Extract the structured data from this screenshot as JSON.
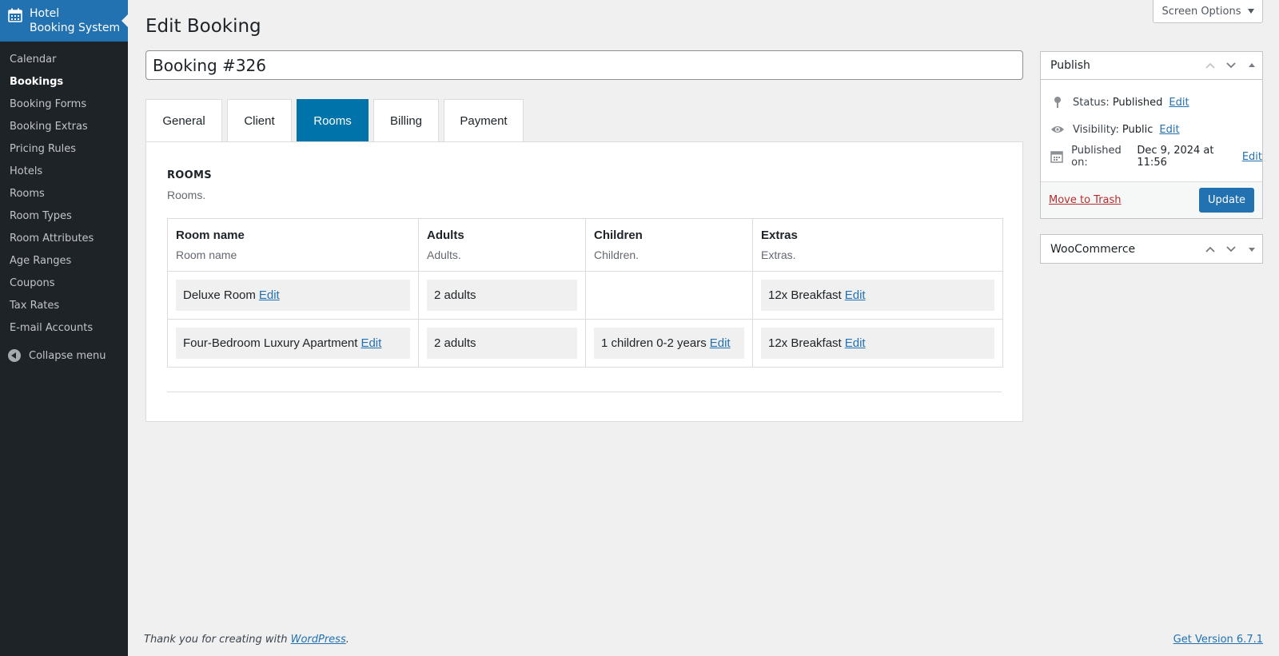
{
  "sidebar": {
    "brand_line1": "Hotel",
    "brand_line2": "Booking System",
    "items": [
      {
        "label": "Calendar"
      },
      {
        "label": "Bookings"
      },
      {
        "label": "Booking Forms"
      },
      {
        "label": "Booking Extras"
      },
      {
        "label": "Pricing Rules"
      },
      {
        "label": "Hotels"
      },
      {
        "label": "Rooms"
      },
      {
        "label": "Room Types"
      },
      {
        "label": "Room Attributes"
      },
      {
        "label": "Age Ranges"
      },
      {
        "label": "Coupons"
      },
      {
        "label": "Tax Rates"
      },
      {
        "label": "E-mail Accounts"
      }
    ],
    "collapse_label": "Collapse menu"
  },
  "header": {
    "screen_options": "Screen Options",
    "page_title": "Edit Booking",
    "booking_title": "Booking #326"
  },
  "tabs": [
    {
      "label": "General"
    },
    {
      "label": "Client"
    },
    {
      "label": "Rooms"
    },
    {
      "label": "Billing"
    },
    {
      "label": "Payment"
    }
  ],
  "rooms": {
    "heading": "ROOMS",
    "description": "Rooms.",
    "columns": [
      {
        "title": "Room name",
        "sub": "Room name"
      },
      {
        "title": "Adults",
        "sub": "Adults."
      },
      {
        "title": "Children",
        "sub": "Children."
      },
      {
        "title": "Extras",
        "sub": "Extras."
      }
    ],
    "rows": [
      {
        "room": "Deluxe Room",
        "adults": "2 adults",
        "children": "",
        "extras": "12x Breakfast"
      },
      {
        "room": "Four-Bedroom Luxury Apartment",
        "adults": "2 adults",
        "children": "1 children 0-2 years",
        "extras": "12x Breakfast"
      }
    ],
    "edit_label": "Edit"
  },
  "publish": {
    "title": "Publish",
    "status_label": "Status:",
    "status_value": "Published",
    "visibility_label": "Visibility:",
    "visibility_value": "Public",
    "published_label": "Published on:",
    "published_value": "Dec 9, 2024 at 11:56",
    "edit_label": "Edit",
    "trash_label": "Move to Trash",
    "update_label": "Update"
  },
  "woocommerce": {
    "title": "WooCommerce"
  },
  "footer": {
    "thanks": "Thank you for creating with",
    "wordpress": "WordPress",
    "period": ".",
    "version": "Get Version 6.7.1"
  }
}
